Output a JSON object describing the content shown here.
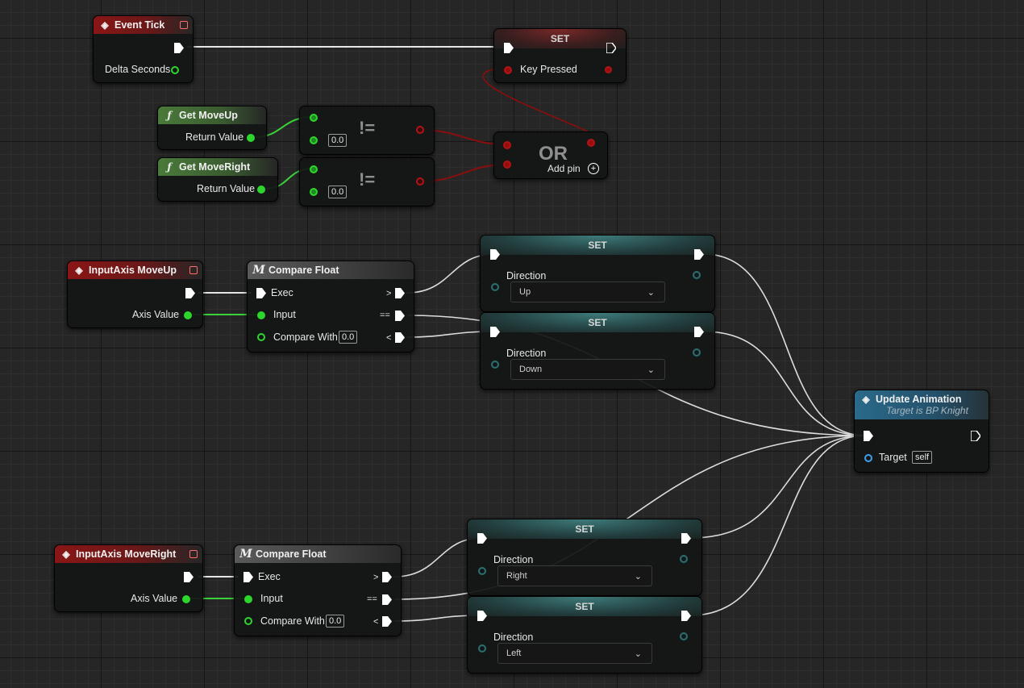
{
  "event_tick": {
    "title": "Event Tick",
    "delta_label": "Delta Seconds"
  },
  "set_key": {
    "title": "SET",
    "var_label": "Key Pressed"
  },
  "get_moveup": {
    "title": "Get MoveUp",
    "ret_label": "Return Value"
  },
  "get_moveright": {
    "title": "Get MoveRight",
    "ret_label": "Return Value"
  },
  "neq_1": {
    "op": "!=",
    "value": "0.0"
  },
  "neq_2": {
    "op": "!=",
    "value": "0.0"
  },
  "or_node": {
    "op": "OR",
    "add_pin": "Add pin"
  },
  "axis_up": {
    "title": "InputAxis MoveUp",
    "axis_label": "Axis Value"
  },
  "axis_right": {
    "title": "InputAxis MoveRight",
    "axis_label": "Axis Value"
  },
  "cmp_up": {
    "title": "Compare Float",
    "exec": "Exec",
    "input": "Input",
    "compare_with": "Compare With",
    "value": "0.0",
    "gt": ">",
    "eq": "==",
    "lt": "<"
  },
  "cmp_right": {
    "title": "Compare Float",
    "exec": "Exec",
    "input": "Input",
    "compare_with": "Compare With",
    "value": "0.0",
    "gt": ">",
    "eq": "==",
    "lt": "<"
  },
  "set_up": {
    "title": "SET",
    "var": "Direction",
    "value": "Up"
  },
  "set_down": {
    "title": "SET",
    "var": "Direction",
    "value": "Down"
  },
  "set_rightdir": {
    "title": "SET",
    "var": "Direction",
    "value": "Right"
  },
  "set_left": {
    "title": "SET",
    "var": "Direction",
    "value": "Left"
  },
  "update_anim": {
    "title": "Update Animation",
    "subtitle": "Target is BP Knight",
    "target": "Target",
    "self": "self"
  },
  "colors": {
    "exec_wire": "#e8e8e8",
    "float_wire": "#3ad43a",
    "bool_wire": "#8a0e0e",
    "event_header": "#8a1616",
    "pure_header": "#4a7a3a",
    "function_header": "#2a6a8a"
  },
  "icons": {
    "event": "diamond-event-icon",
    "function": "function-f-icon",
    "macro": "macro-m-icon",
    "add": "plus-circle-icon",
    "dropdown": "chevron-down-icon"
  }
}
